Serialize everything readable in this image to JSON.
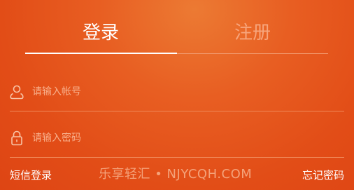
{
  "tabs": {
    "login_label": "登录",
    "register_label": "注册",
    "active": "login"
  },
  "account_field": {
    "placeholder": "请输入帐号",
    "value": "",
    "icon": "user-icon"
  },
  "password_field": {
    "placeholder": "请输入密码",
    "value": "",
    "icon": "lock-icon"
  },
  "footer": {
    "sms_login_label": "短信登录",
    "forgot_password_label": "忘记密码"
  },
  "watermark": {
    "text": "乐享轻汇 • NJYCQH.COM"
  },
  "colors": {
    "background": "#e24d17",
    "highlight": "#ec7a33",
    "text_active": "#ffffff",
    "text_muted": "#f8b08c"
  }
}
